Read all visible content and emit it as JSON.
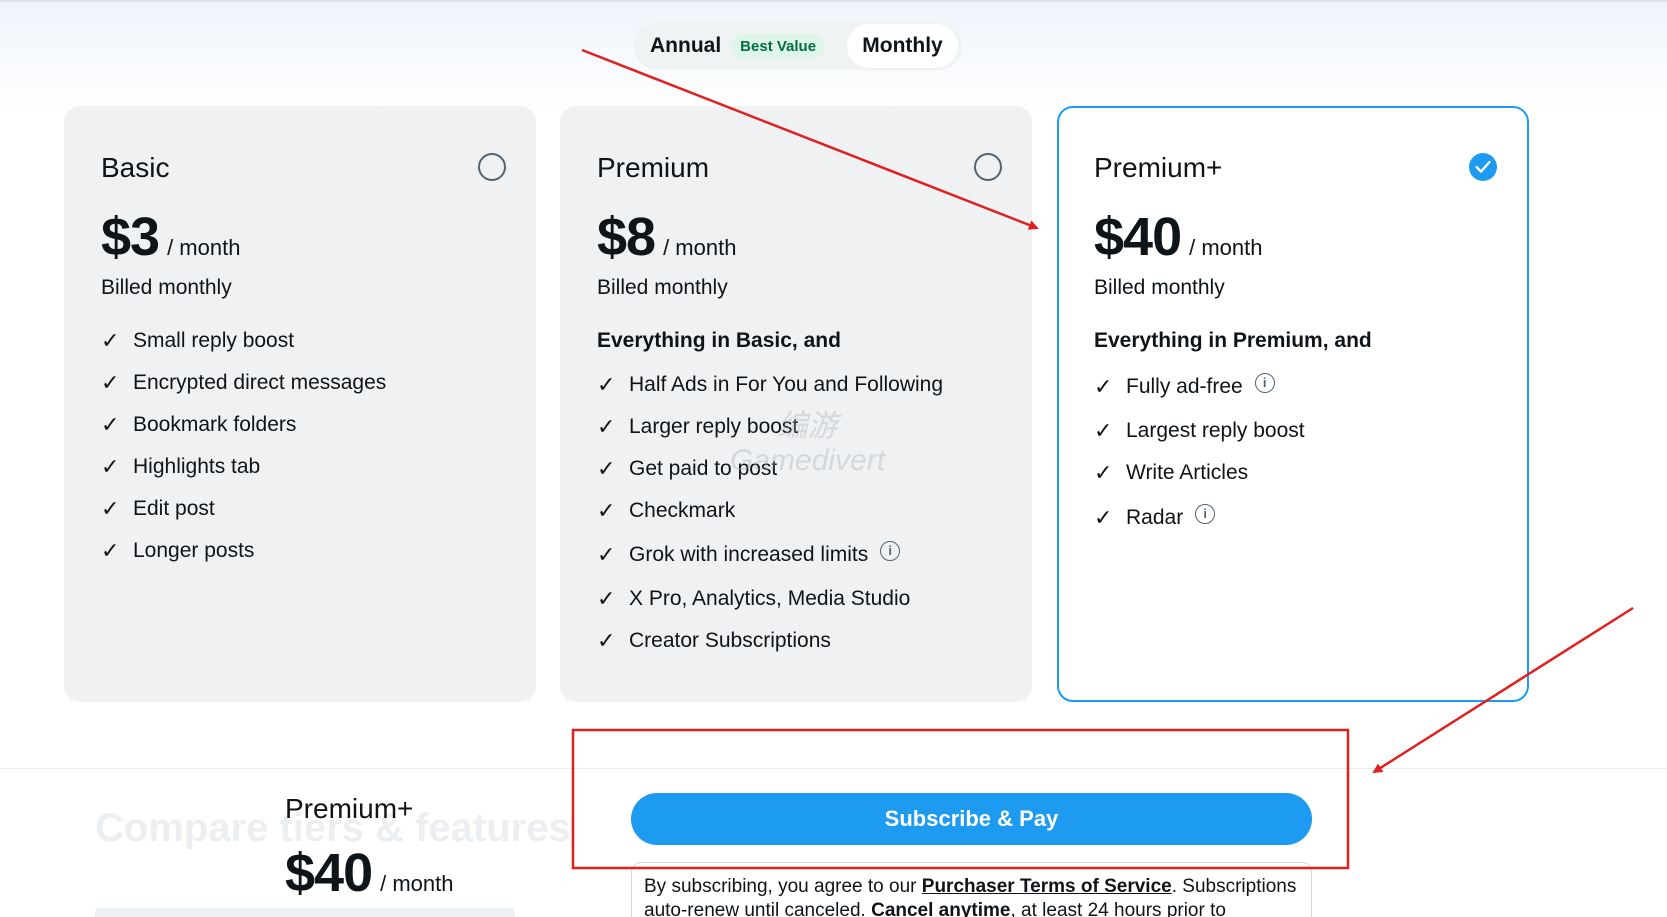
{
  "toggle": {
    "annual_label": "Annual",
    "badge": "Best Value",
    "monthly_label": "Monthly",
    "selected": "Monthly"
  },
  "plans": [
    {
      "name": "Basic",
      "price": "$3",
      "unit": "/ month",
      "billed": "Billed monthly",
      "intro": "",
      "selected": false,
      "features": [
        "Small reply boost",
        "Encrypted direct messages",
        "Bookmark folders",
        "Highlights tab",
        "Edit post",
        "Longer posts"
      ]
    },
    {
      "name": "Premium",
      "price": "$8",
      "unit": "/ month",
      "billed": "Billed monthly",
      "intro": "Everything in Basic, and",
      "selected": false,
      "features": [
        "Half Ads in For You and Following",
        "Larger reply boost",
        "Get paid to post",
        "Checkmark",
        "Grok with increased limits",
        "X Pro, Analytics, Media Studio",
        "Creator Subscriptions"
      ]
    },
    {
      "name": "Premium+",
      "price": "$40",
      "unit": "/ month",
      "billed": "Billed monthly",
      "intro": "Everything in Premium, and",
      "selected": true,
      "features": [
        "Fully ad-free",
        "Largest reply boost",
        "Write Articles",
        "Radar"
      ]
    }
  ],
  "compare_heading": "Compare tiers & features",
  "summary": {
    "name": "Premium+",
    "price": "$40",
    "unit": "/ month"
  },
  "subscribe_label": "Subscribe & Pay",
  "terms": {
    "prefix": "By subscribing, you agree to our ",
    "link1": "Purchaser Terms of Service",
    "mid": ". Subscriptions auto-renew until canceled. ",
    "link2": "Cancel anytime",
    "suffix": ",  at least 24 hours prior to"
  },
  "watermark": {
    "line1": "编游",
    "line2": "Gamedivert"
  },
  "colors": {
    "accent": "#1d9bf0",
    "annotation": "#e0201f",
    "badge_bg": "#e0f5ea",
    "badge_text": "#00703d"
  }
}
